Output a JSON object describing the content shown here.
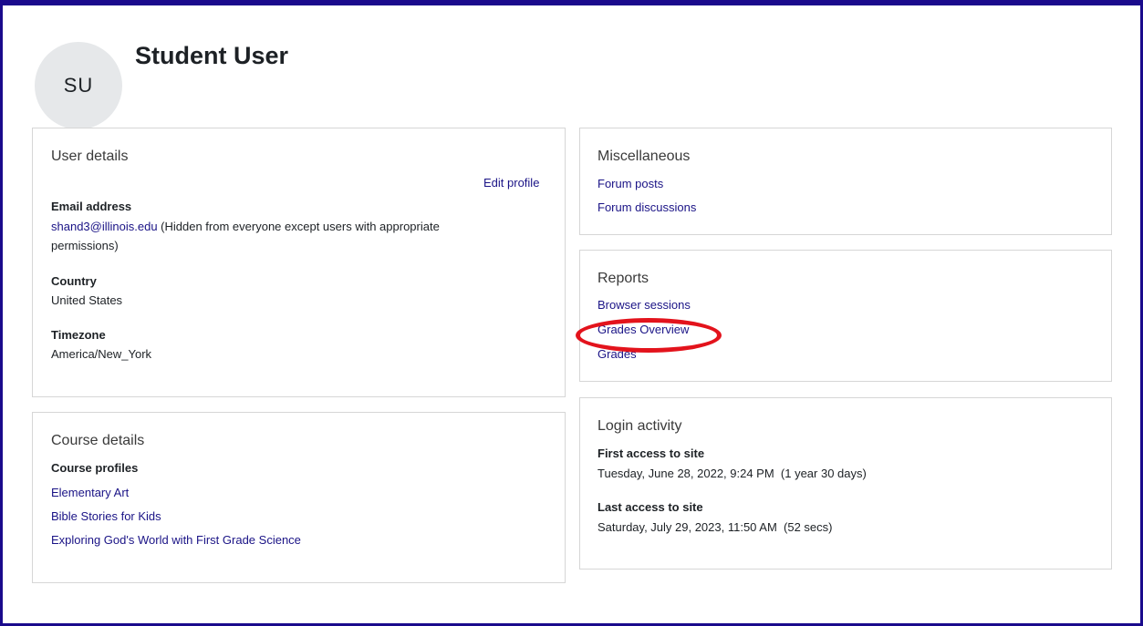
{
  "profile": {
    "initials": "SU",
    "name": "Student User"
  },
  "user_details": {
    "title": "User details",
    "edit_profile": "Edit profile",
    "email_label": "Email address",
    "email_value": "shand3@illinois.edu",
    "email_note": " (Hidden from everyone except users with appropriate permissions)",
    "country_label": "Country",
    "country_value": "United States",
    "timezone_label": "Timezone",
    "timezone_value": "America/New_York"
  },
  "course_details": {
    "title": "Course details",
    "profiles_label": "Course profiles",
    "courses": [
      "Elementary Art",
      "Bible Stories for Kids",
      "Exploring God's World with First Grade Science"
    ]
  },
  "miscellaneous": {
    "title": "Miscellaneous",
    "links": [
      "Forum posts",
      "Forum discussions"
    ]
  },
  "reports": {
    "title": "Reports",
    "links": [
      "Browser sessions",
      "Grades Overview",
      "Grades"
    ]
  },
  "login_activity": {
    "title": "Login activity",
    "first_label": "First access to site",
    "first_value": "Tuesday, June 28, 2022, 9:24 PM  (1 year 30 days)",
    "last_label": "Last access to site",
    "last_value": "Saturday, July 29, 2023, 11:50 AM  (52 secs)"
  },
  "colors": {
    "frame": "#1a0a8c",
    "link": "#1a1386",
    "highlight": "#e3131c"
  }
}
